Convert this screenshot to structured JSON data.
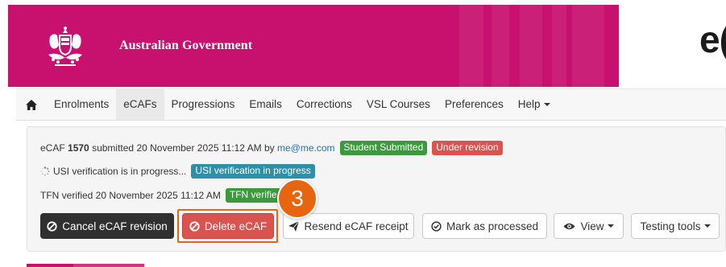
{
  "header": {
    "government_name": "Australian Government",
    "brand_partial": "e(",
    "banner_color": "#c8106e"
  },
  "nav": {
    "home_icon": "home-icon",
    "items": [
      {
        "label": "Enrolments"
      },
      {
        "label": "eCAFs"
      },
      {
        "label": "Progressions"
      },
      {
        "label": "Emails"
      },
      {
        "label": "Corrections"
      },
      {
        "label": "VSL Courses"
      },
      {
        "label": "Preferences"
      },
      {
        "label": "Help"
      }
    ]
  },
  "ecaf": {
    "prefix": "eCAF",
    "number": "1570",
    "submitted_text": "submitted 20 November 2025 11:12 AM by",
    "submitter_email": "me@me.com",
    "status_badges": [
      {
        "label": "Student Submitted",
        "color": "#3c9a3c"
      },
      {
        "label": "Under revision",
        "color": "#d9534f"
      }
    ],
    "usi_text": "USI verification is in progress...",
    "usi_badge": {
      "label": "USI verification in progress",
      "color": "#2e8fa8"
    },
    "tfn_text": "TFN verified 20 November 2025 11:12 AM",
    "tfn_badge": {
      "label": "TFN verifie",
      "color": "#3c9a3c"
    }
  },
  "actions": {
    "cancel_revision": "Cancel eCAF revision",
    "delete": "Delete eCAF",
    "resend_receipt": "Resend eCAF receipt",
    "mark_processed": "Mark as processed",
    "view": "View",
    "testing_tools": "Testing tools"
  },
  "annotation": {
    "step_number": "3",
    "color": "#e8650f"
  }
}
